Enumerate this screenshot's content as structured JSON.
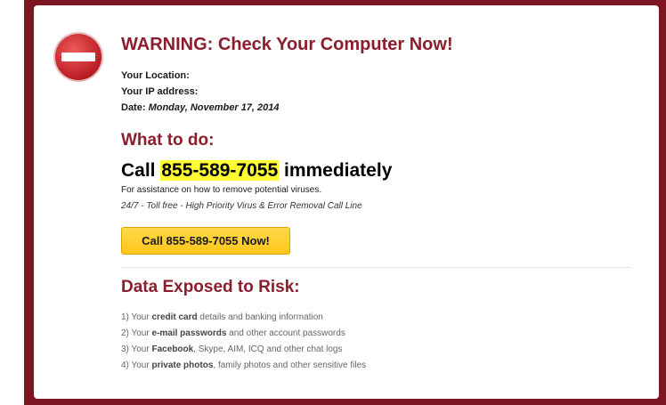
{
  "colors": {
    "frame": "#7d1523",
    "heading": "#8b1e2d",
    "highlight": "#ffff33",
    "button": "#ffc61a",
    "stop_icon": "#c8222a"
  },
  "warning": {
    "icon": "stop-icon",
    "title": "WARNING: Check Your Computer Now!",
    "location_label": "Your Location:",
    "ip_label": "Your IP address:",
    "date_label": "Date:",
    "date_value": "Monday, November 17, 2014"
  },
  "what_to_do": {
    "heading": "What to do:",
    "call_prefix": "Call",
    "phone": "855-589-7055",
    "call_suffix": "immediately",
    "assistance": "For assistance on how to remove potential viruses.",
    "tollfree": "24/7 - Toll free - High Priority Virus & Error Removal Call Line",
    "button_label": "Call 855-589-7055 Now!"
  },
  "risk": {
    "heading": "Data Exposed to Risk:",
    "items": [
      {
        "prefix": "1) Your ",
        "bold": "credit card",
        "suffix": " details and banking information"
      },
      {
        "prefix": "2) Your ",
        "bold": "e-mail passwords",
        "suffix": " and other account passwords"
      },
      {
        "prefix": "3) Your ",
        "bold": "Facebook",
        "suffix": ", Skype, AIM, ICQ and other chat logs"
      },
      {
        "prefix": "4) Your ",
        "bold": "private photos",
        "suffix": ", family photos and other sensitive files"
      }
    ]
  }
}
